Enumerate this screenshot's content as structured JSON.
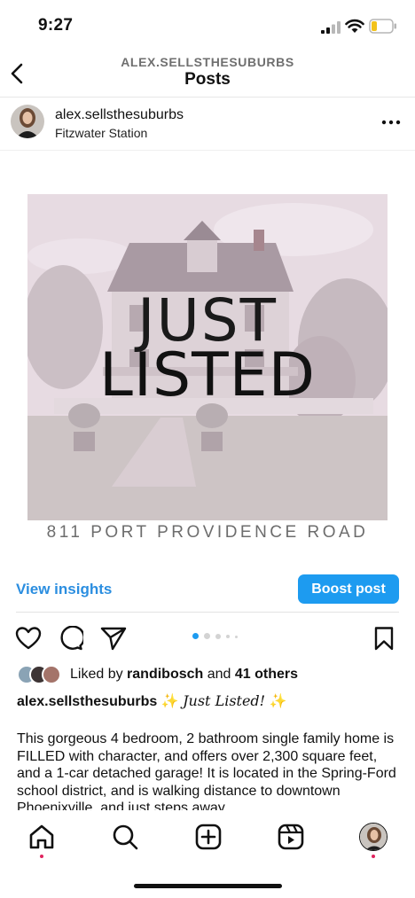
{
  "status": {
    "time": "9:27"
  },
  "header": {
    "username": "ALEX.SELLSTHESUBURBS",
    "title": "Posts"
  },
  "post": {
    "username": "alex.sellsthesuburbs",
    "location": "Fitzwater Station",
    "image_text": {
      "line1": "JUST",
      "line2": "LISTED",
      "address": "811 PORT PROVIDENCE ROAD"
    },
    "carousel": {
      "count": 4,
      "active": 0
    },
    "view_insights": "View insights",
    "boost_post": "Boost post",
    "likes": {
      "prefix": "Liked by",
      "user": "randibosch",
      "joiner": "and",
      "others": "41 others"
    },
    "caption_user": "alex.sellsthesuburbs",
    "caption_sparkle": "✨",
    "caption_title": "Just Listed!",
    "caption_body": "This gorgeous 4 bedroom, 2 bathroom single family home is FILLED with character, and offers over 2,300 square feet, and a 1-car detached garage! It is located in the Spring-Ford school district, and is walking distance to downtown Phoenixville, and just steps away"
  },
  "colors": {
    "accent": "#1d9bf0",
    "link": "#2b8ee0",
    "notification": "#e0245e"
  },
  "tabs": [
    "home-icon",
    "search-icon",
    "create-icon",
    "reels-icon",
    "profile-avatar"
  ]
}
